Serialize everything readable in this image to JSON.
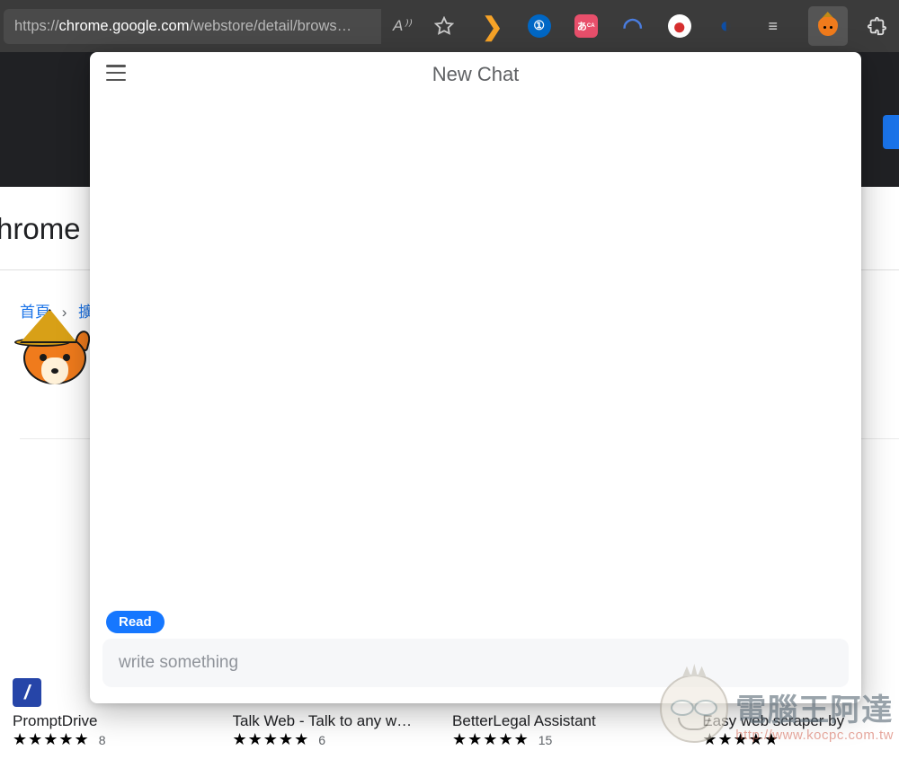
{
  "toolbar": {
    "url_prefix": "https://",
    "url_host": "chrome.google.com",
    "url_path": "/webstore/detail/brows…",
    "read_aloud_label": "A⁾⁾"
  },
  "popup": {
    "title": "New Chat",
    "read_chip": "Read",
    "composer_placeholder": "write something"
  },
  "store": {
    "title_fragment": "hrome 線",
    "breadcrumb_home": "首頁",
    "breadcrumb_next_fragment": "擴",
    "cards": [
      {
        "name": "PromptDrive",
        "rating_count": "8"
      },
      {
        "name": "Talk Web - Talk to any w…",
        "rating_count": "6"
      },
      {
        "name": "BetterLegal Assistant",
        "rating_count": "15"
      },
      {
        "name": "Easy web scraper by",
        "rating_count": ""
      }
    ]
  },
  "watermark": {
    "cn": "電腦王阿達",
    "url": "http://www.kocpc.com.tw"
  }
}
